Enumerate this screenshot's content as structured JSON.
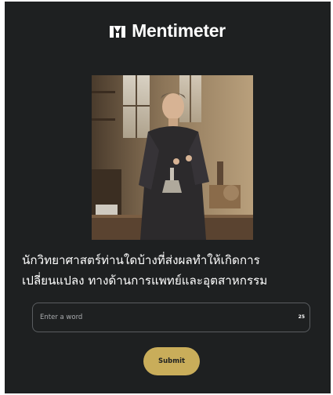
{
  "app": {
    "brand_name": "Mentimeter",
    "brand_icon": "mentimeter-logo-icon",
    "colors": {
      "background": "#1e2021",
      "text": "#ffffff",
      "accent": "#c9ad5a",
      "input_border": "#5a5d60",
      "placeholder": "#a9abae"
    }
  },
  "question": {
    "image_icon": "scientist-photo",
    "lines": [
      "นักวิทยาศาสตร์ท่านใดบ้างที่ส่งผลทำให้เกิดการ",
      "เปลี่ยนแปลง ทางด้านการแพทย์และอุตสาหกรรม"
    ]
  },
  "answer": {
    "placeholder": "Enter a word",
    "value": "",
    "char_limit": "25"
  },
  "submit": {
    "label": "Submit"
  }
}
